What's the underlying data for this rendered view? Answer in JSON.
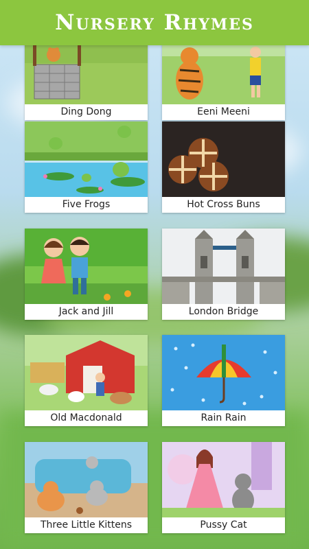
{
  "header": {
    "title": "Nursery Rhymes"
  },
  "rhymes": [
    {
      "label": "Ding Dong"
    },
    {
      "label": "Eeni Meeni"
    },
    {
      "label": "Five Frogs"
    },
    {
      "label": "Hot Cross Buns"
    },
    {
      "label": "Jack and Jill"
    },
    {
      "label": "London Bridge"
    },
    {
      "label": "Old Macdonald"
    },
    {
      "label": "Rain Rain"
    },
    {
      "label": "Three Little Kittens"
    },
    {
      "label": "Pussy Cat"
    }
  ],
  "colors": {
    "header": "#8cc63f",
    "card": "#ffffff"
  }
}
